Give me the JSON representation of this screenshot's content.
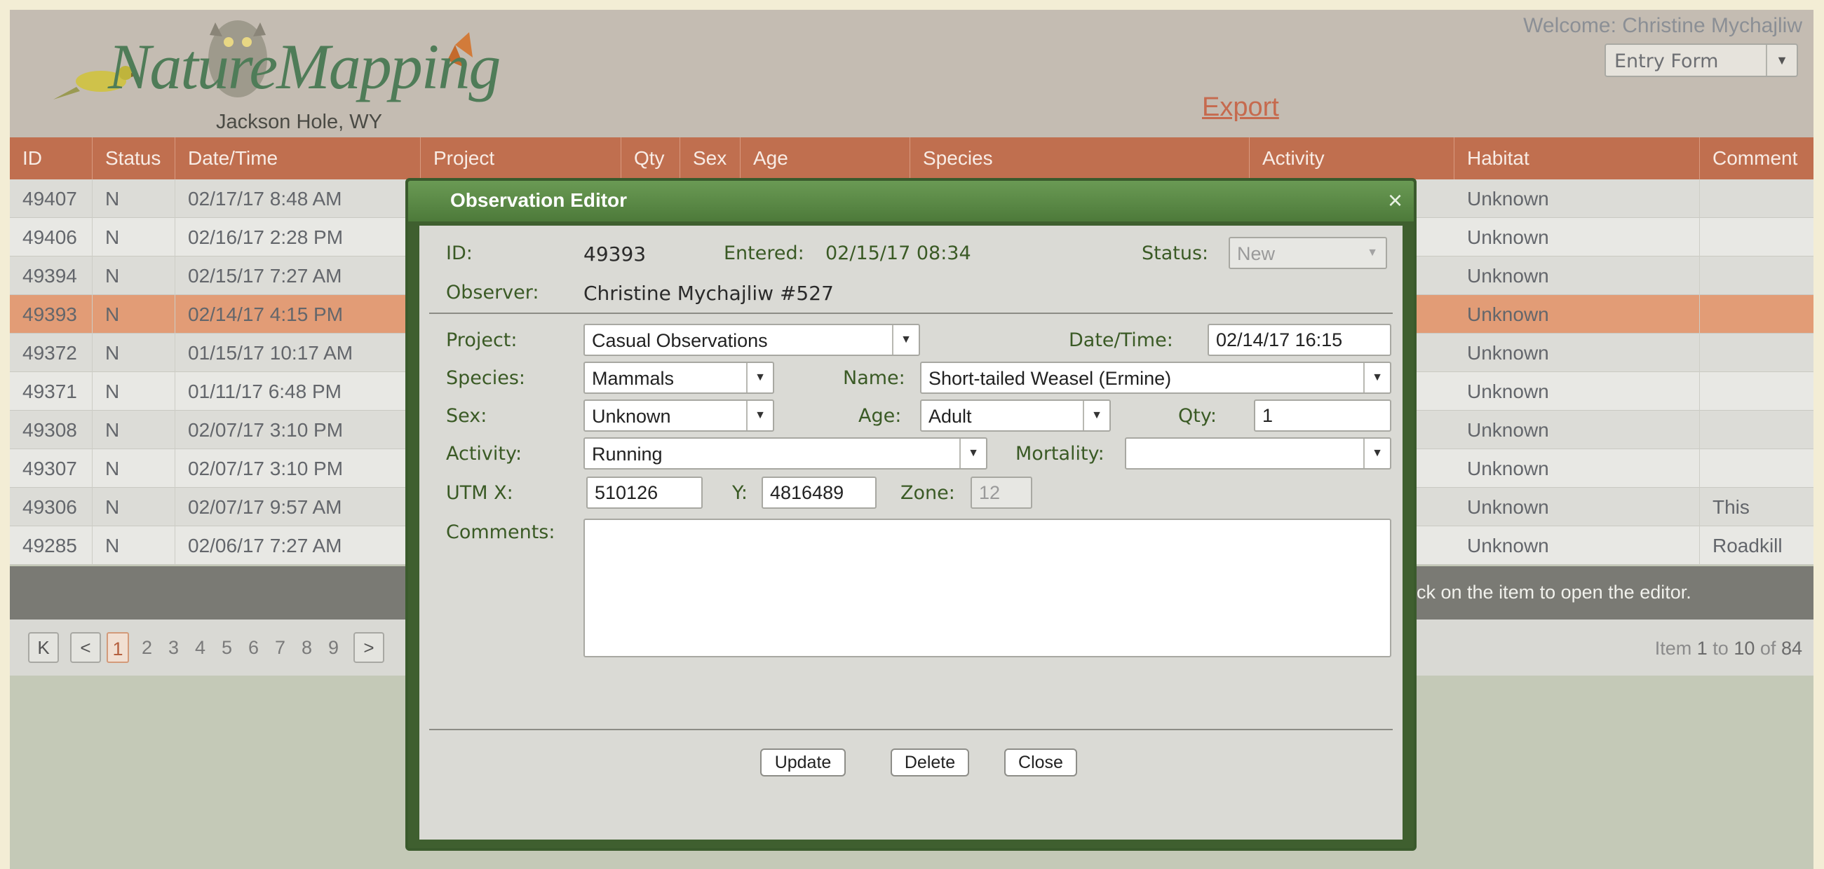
{
  "app": {
    "logo_text": "NatureMapping",
    "logo_subtitle": "Jackson Hole, WY",
    "welcome": "Welcome: Christine Mychajliw",
    "view_select": "Entry Form",
    "export_label": "Export"
  },
  "grid": {
    "columns": [
      "ID",
      "Status",
      "Date/Time",
      "Project",
      "Qty",
      "Sex",
      "Age",
      "Species",
      "Activity",
      "Habitat",
      "Comment"
    ],
    "rows": [
      {
        "id": "49407",
        "status": "N",
        "datetime": "02/17/17 8:48 AM",
        "habitat": "Unknown",
        "comment": ""
      },
      {
        "id": "49406",
        "status": "N",
        "datetime": "02/16/17 2:28 PM",
        "habitat": "Unknown",
        "comment": ""
      },
      {
        "id": "49394",
        "status": "N",
        "datetime": "02/15/17 7:27 AM",
        "habitat": "Unknown",
        "comment": ""
      },
      {
        "id": "49393",
        "status": "N",
        "datetime": "02/14/17 4:15 PM",
        "habitat": "Unknown",
        "comment": ""
      },
      {
        "id": "49372",
        "status": "N",
        "datetime": "01/15/17 10:17 AM",
        "habitat": "Unknown",
        "comment": ""
      },
      {
        "id": "49371",
        "status": "N",
        "datetime": "01/11/17 6:48 PM",
        "habitat": "Unknown",
        "comment": ""
      },
      {
        "id": "49308",
        "status": "N",
        "datetime": "02/07/17 3:10 PM",
        "habitat": "Unknown",
        "comment": ""
      },
      {
        "id": "49307",
        "status": "N",
        "datetime": "02/07/17 3:10 PM",
        "habitat": "Unknown",
        "comment": ""
      },
      {
        "id": "49306",
        "status": "N",
        "datetime": "02/07/17 9:57 AM",
        "habitat": "Unknown",
        "comment": "This"
      },
      {
        "id": "49285",
        "status": "N",
        "datetime": "02/06/17 7:27 AM",
        "habitat": "Unknown",
        "comment": "Roadkill"
      }
    ],
    "selected_id": "49393",
    "status_hint": "ck on the item to open the editor."
  },
  "pager": {
    "first": "K",
    "prev": "<",
    "next": ">",
    "pages": [
      "1",
      "2",
      "3",
      "4",
      "5",
      "6",
      "7",
      "8",
      "9"
    ],
    "current": "1",
    "info_prefix": "Item",
    "from": "1",
    "to_word": "to",
    "to": "10",
    "of_word": "of",
    "total": "84"
  },
  "editor": {
    "title": "Observation Editor",
    "close_icon": "×",
    "id_label": "ID:",
    "id_value": "49393",
    "entered_label": "Entered:",
    "entered_value": "02/15/17 08:34",
    "status_label": "Status:",
    "status_value": "New",
    "observer_label": "Observer:",
    "observer_value": "Christine Mychajliw #527",
    "project_label": "Project:",
    "project_value": "Casual Observations",
    "datetime_label": "Date/Time:",
    "datetime_value": "02/14/17 16:15",
    "species_label": "Species:",
    "species_value": "Mammals",
    "name_label": "Name:",
    "name_value": "Short-tailed Weasel (Ermine)",
    "sex_label": "Sex:",
    "sex_value": "Unknown",
    "age_label": "Age:",
    "age_value": "Adult",
    "qty_label": "Qty:",
    "qty_value": "1",
    "activity_label": "Activity:",
    "activity_value": "Running",
    "mortality_label": "Mortality:",
    "mortality_value": "",
    "utmx_label": "UTM X:",
    "utmx_value": "510126",
    "y_label": "Y:",
    "y_value": "4816489",
    "zone_label": "Zone:",
    "zone_value": "12",
    "comments_label": "Comments:",
    "comments_value": "",
    "update_label": "Update",
    "delete_label": "Delete",
    "close_label": "Close"
  },
  "colors": {
    "header_bar": "#c06f4f",
    "selected_row": "#e29c76",
    "modal_frame": "#3f5f2f",
    "modal_title": "#5b8a45",
    "label_green": "#3a5a25",
    "export_link": "#c66a4e"
  }
}
